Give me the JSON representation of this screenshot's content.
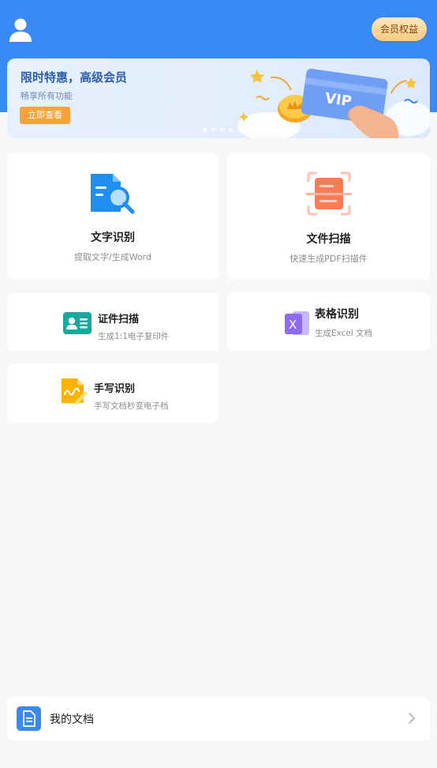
{
  "header": {
    "member_button": "会员权益",
    "bg_color": "#3a8af5"
  },
  "banner": {
    "title": "限时特惠，高级会员",
    "subtitle": "畅享所有功能",
    "button": "立即查看",
    "card_text": "VIP",
    "slide_count": 4,
    "active_slide": 1
  },
  "features": {
    "text_ocr": {
      "title": "文字识别",
      "subtitle": "提取文字/生成Word",
      "icon": "document-search-icon"
    },
    "file_scan": {
      "title": "文件扫描",
      "subtitle": "快速生成PDF扫描件",
      "icon": "scan-document-icon"
    },
    "id_scan": {
      "title": "证件扫描",
      "subtitle": "生成1:1电子复印件",
      "icon": "id-card-icon"
    },
    "table_ocr": {
      "title": "表格识别",
      "subtitle": "生成Excel 文档",
      "icon": "excel-icon"
    },
    "handwriting_ocr": {
      "title": "手写识别",
      "subtitle": "手写文档秒变电子档",
      "icon": "handwriting-icon"
    }
  },
  "my_docs": {
    "label": "我的文档",
    "icon": "document-icon",
    "arrow": "chevron-right-icon"
  }
}
